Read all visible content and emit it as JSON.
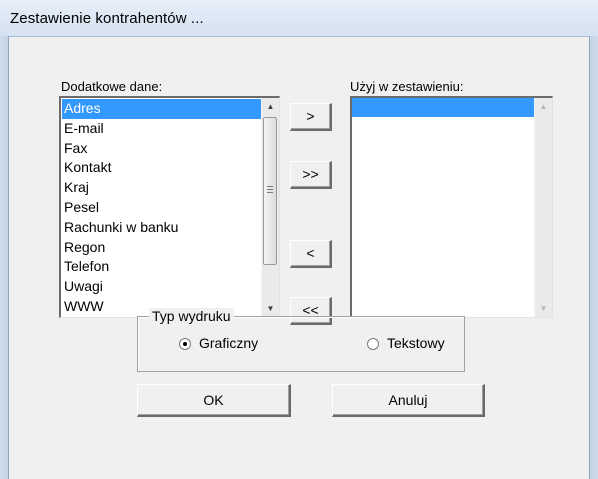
{
  "window": {
    "title": "Zestawienie kontrahentów ..."
  },
  "left_list": {
    "label": "Dodatkowe dane:",
    "items": [
      "Adres",
      "E-mail",
      "Fax",
      "Kontakt",
      "Kraj",
      "Pesel",
      "Rachunki w banku",
      "Regon",
      "Telefon",
      "Uwagi",
      "WWW"
    ],
    "selected": "Adres"
  },
  "right_list": {
    "label": "Użyj w zestawieniu:",
    "items": []
  },
  "move_buttons": {
    "add": ">",
    "add_all": ">>",
    "remove": "<",
    "remove_all": "<<"
  },
  "print_type": {
    "label": "Typ wydruku",
    "options": [
      "Graficzny",
      "Tekstowy"
    ],
    "selected": "Graficzny"
  },
  "actions": {
    "ok": "OK",
    "cancel": "Anuluj"
  },
  "icons": {
    "scroll_up": "scroll-up-arrow-icon",
    "scroll_down": "scroll-down-arrow-icon",
    "radio_checked": "radio-checked-icon",
    "radio_unchecked": "radio-unchecked-icon"
  },
  "colors": {
    "selection": "#3399ff",
    "dialog_bg": "#f0f0f0",
    "titlebar": "#dbe6f4"
  }
}
